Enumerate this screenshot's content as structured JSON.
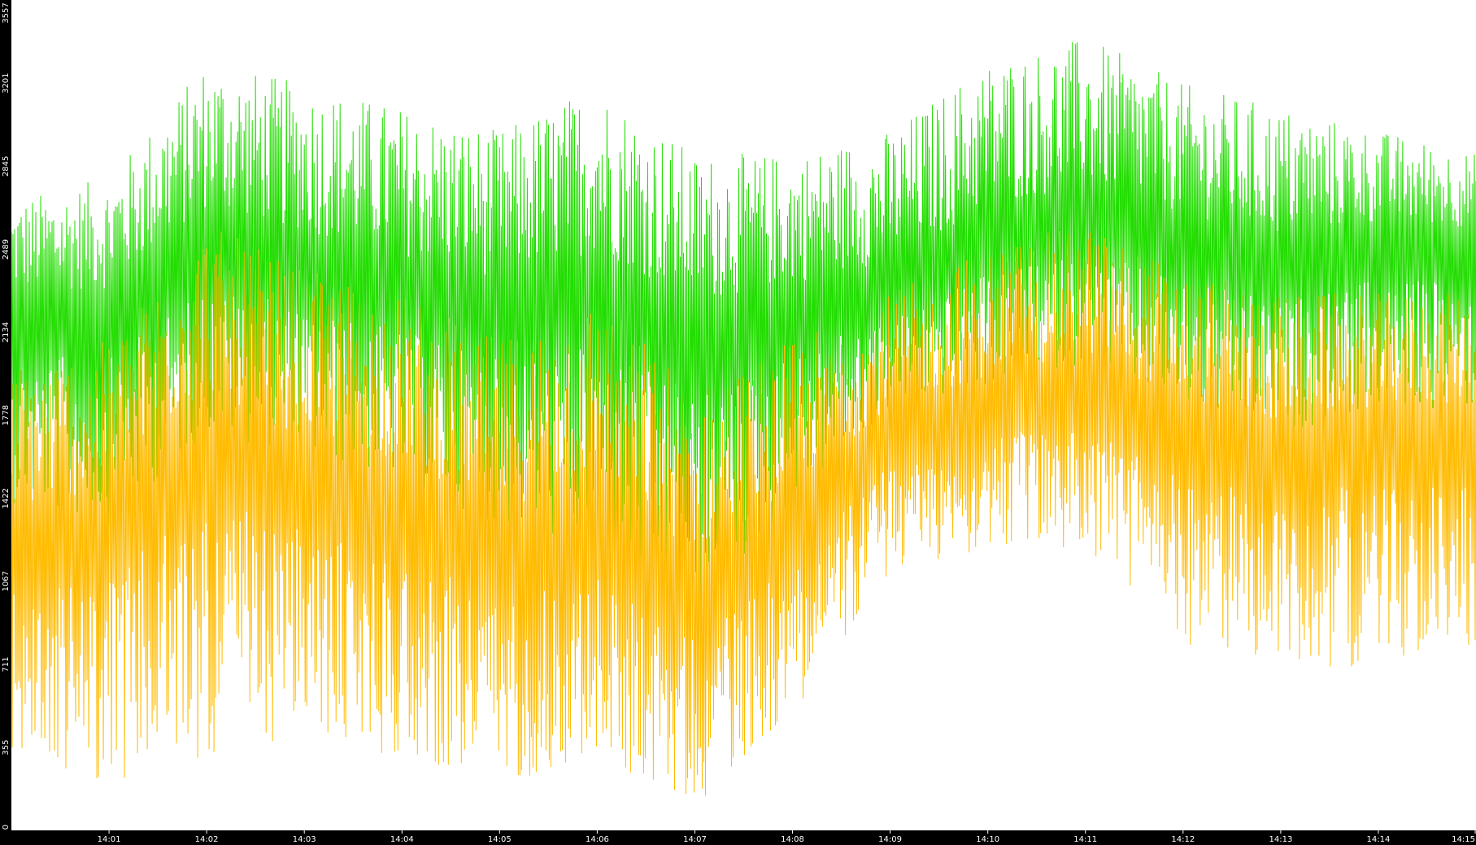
{
  "chart_data": {
    "type": "line",
    "title": "",
    "xlabel": "",
    "ylabel": "",
    "grid": false,
    "legend": "none",
    "ylim": [
      0,
      3557
    ],
    "xlim": [
      "14:00:00",
      "14:15:00"
    ],
    "y_ticks": [
      "0",
      "355",
      "711",
      "1067",
      "1422",
      "1778",
      "2134",
      "2489",
      "2845",
      "3201",
      "3557"
    ],
    "x_ticks": [
      "14:01",
      "14:02",
      "14:03",
      "14:04",
      "14:05",
      "14:06",
      "14:07",
      "14:08",
      "14:09",
      "14:10",
      "14:11",
      "14:12",
      "14:13",
      "14:14",
      "14:15"
    ],
    "series": [
      {
        "color": "#22dd00",
        "style": "dense oscillating line",
        "x": [
          "14:00:00",
          "14:01:00",
          "14:02:00",
          "14:03:00",
          "14:04:00",
          "14:05:00",
          "14:06:00",
          "14:07:00",
          "14:08:00",
          "14:09:00",
          "14:10:00",
          "14:11:00",
          "14:12:00",
          "14:13:00",
          "14:14:00",
          "14:15:00"
        ],
        "low": [
          1400,
          1300,
          1700,
          1600,
          1500,
          1300,
          1200,
          900,
          1400,
          1800,
          1900,
          2000,
          1800,
          1700,
          1800,
          1800
        ],
        "mid": [
          2200,
          2200,
          2500,
          2400,
          2300,
          2200,
          2300,
          2100,
          2200,
          2300,
          2500,
          2600,
          2500,
          2400,
          2500,
          2500
        ],
        "high": [
          2700,
          2800,
          3300,
          3200,
          3100,
          3000,
          3200,
          2900,
          2900,
          3000,
          3300,
          3400,
          3200,
          3100,
          3000,
          2900
        ]
      },
      {
        "color": "#ffbb00",
        "style": "dense oscillating line",
        "x": [
          "14:00:00",
          "14:01:00",
          "14:02:00",
          "14:03:00",
          "14:04:00",
          "14:05:00",
          "14:06:00",
          "14:07:00",
          "14:08:00",
          "14:09:00",
          "14:10:00",
          "14:11:00",
          "14:12:00",
          "14:13:00",
          "14:14:00",
          "14:15:00"
        ],
        "low": [
          300,
          200,
          300,
          400,
          300,
          200,
          300,
          100,
          500,
          1100,
          1200,
          1200,
          800,
          700,
          700,
          800
        ],
        "mid": [
          1200,
          1300,
          1700,
          1500,
          1400,
          1200,
          1300,
          1000,
          1300,
          1700,
          1800,
          1900,
          1700,
          1600,
          1700,
          1700
        ],
        "high": [
          2000,
          2100,
          2600,
          2400,
          2300,
          2100,
          2300,
          1900,
          2100,
          2300,
          2500,
          2600,
          2400,
          2300,
          2300,
          2300
        ]
      }
    ]
  },
  "colors": {
    "background": "#ffffff",
    "axis_bar": "#000000",
    "tick_text": "#ffffff"
  }
}
